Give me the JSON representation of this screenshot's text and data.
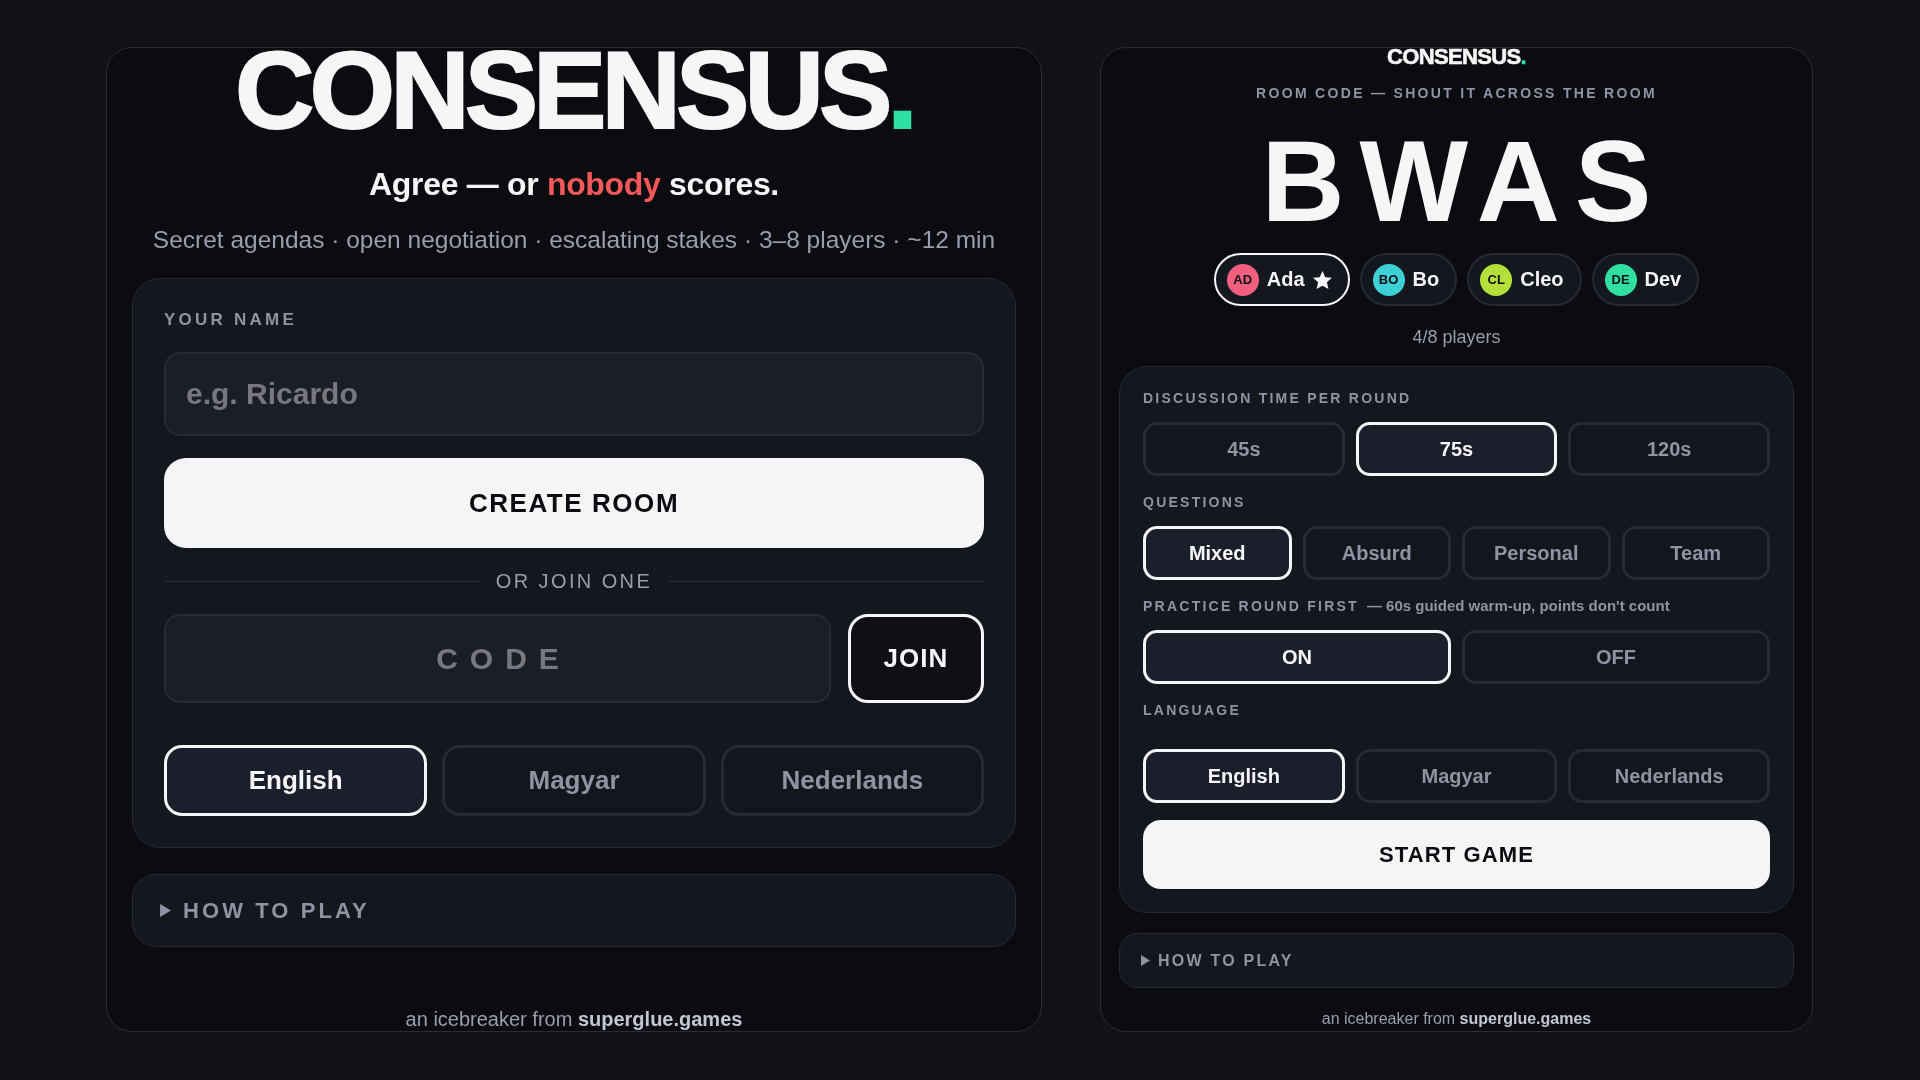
{
  "join_screen": {
    "logo": {
      "word": "CONSENSUS",
      "dot": "."
    },
    "tagline": {
      "before": "Agree — or",
      "highlight": "nobody",
      "after": "scores."
    },
    "summary": "Secret agendas · open negotiation · escalating stakes · 3–8 players · ~12 min",
    "name_field": {
      "label": "YOUR NAME",
      "placeholder": "e.g. Ricardo"
    },
    "create_button": "CREATE ROOM",
    "divider": "OR JOIN ONE",
    "code_field": {
      "placeholder": "CODE"
    },
    "join_button": "JOIN",
    "languages": [
      {
        "label": "English",
        "selected": true
      },
      {
        "label": "Magyar",
        "selected": false
      },
      {
        "label": "Nederlands",
        "selected": false
      }
    ],
    "how_to_play": {
      "label": "HOW TO PLAY",
      "expanded": false
    },
    "footer": {
      "text": "an icebreaker from",
      "link": "superglue.games"
    }
  },
  "lobby_screen": {
    "logo": {
      "word": "CONSENSUS",
      "dot": "."
    },
    "caption": "ROOM CODE — SHOUT IT ACROSS THE ROOM",
    "room_code": "BWAS",
    "players": [
      {
        "initials": "AD",
        "name": "Ada",
        "color": "#f0607e",
        "host": true
      },
      {
        "initials": "BO",
        "name": "Bo",
        "color": "#3dd0d6",
        "host": false
      },
      {
        "initials": "CL",
        "name": "Cleo",
        "color": "#b5e03c",
        "host": false
      },
      {
        "initials": "DE",
        "name": "Dev",
        "color": "#2fe0a0",
        "host": false
      }
    ],
    "player_count": "4/8 players",
    "settings": [
      {
        "label": "DISCUSSION TIME PER ROUND",
        "options": [
          {
            "label": "45s",
            "selected": false
          },
          {
            "label": "75s",
            "selected": true
          },
          {
            "label": "120s",
            "selected": false
          }
        ]
      },
      {
        "label": "QUESTIONS",
        "options": [
          {
            "label": "Mixed",
            "selected": true
          },
          {
            "label": "Absurd",
            "selected": false
          },
          {
            "label": "Personal",
            "selected": false
          },
          {
            "label": "Team",
            "selected": false
          }
        ]
      },
      {
        "label": "PRACTICE ROUND FIRST",
        "hint": "— 60s guided warm-up, points don't count",
        "options": [
          {
            "label": "ON",
            "selected": true
          },
          {
            "label": "OFF",
            "selected": false
          }
        ]
      },
      {
        "label": "LANGUAGE",
        "options": [
          {
            "label": "English",
            "selected": true
          },
          {
            "label": "Magyar",
            "selected": false
          },
          {
            "label": "Nederlands",
            "selected": false
          }
        ]
      }
    ],
    "start_button": "START GAME",
    "how_to_play": {
      "label": "HOW TO PLAY",
      "expanded": false
    },
    "footer": {
      "text": "an icebreaker from",
      "link": "superglue.games"
    }
  }
}
